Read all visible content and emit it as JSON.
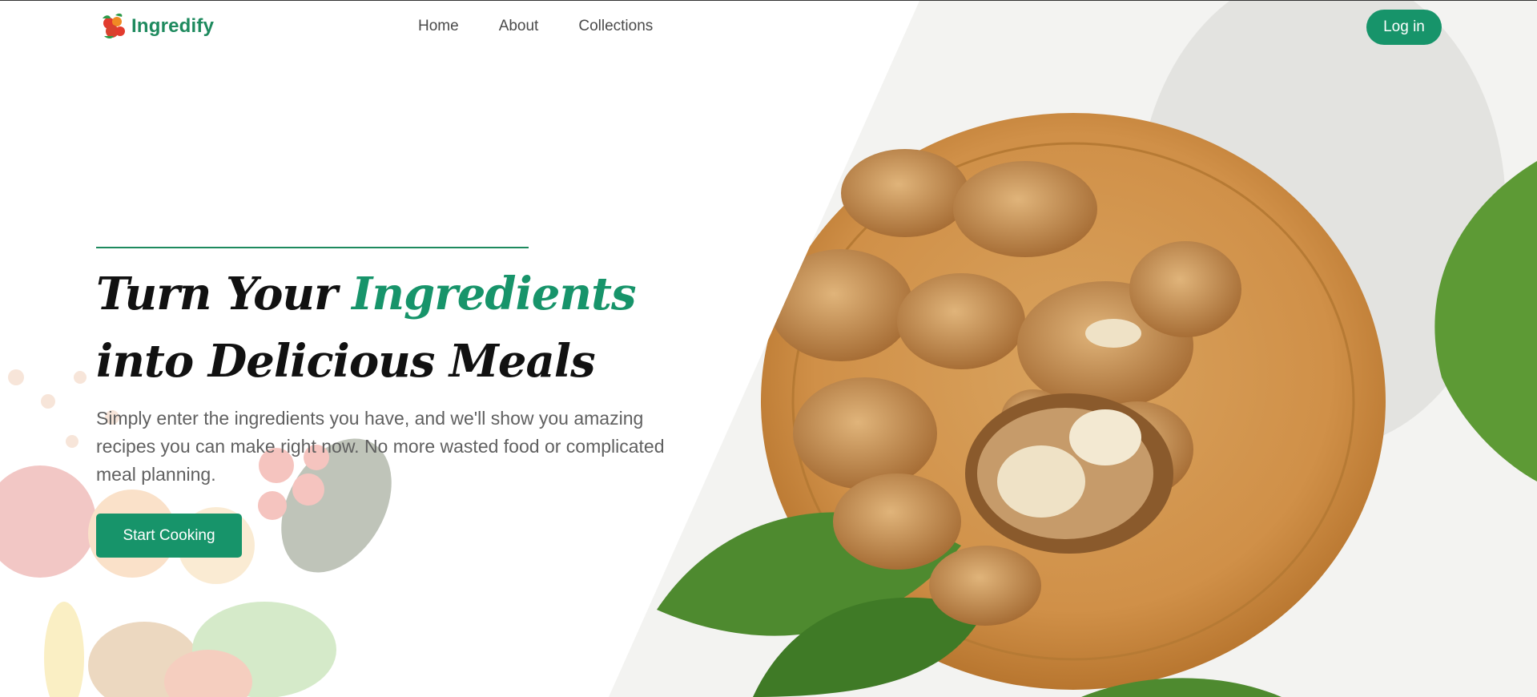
{
  "brand": {
    "name": "Ingredify"
  },
  "nav": {
    "items": [
      {
        "label": "Home"
      },
      {
        "label": "About"
      },
      {
        "label": "Collections"
      }
    ]
  },
  "header": {
    "login_label": "Log in"
  },
  "hero": {
    "headline_part1": "Turn Your ",
    "headline_highlight": "Ingredients",
    "headline_part2": " into Delicious Meals",
    "subtext": "Simply enter the ingredients you have, and we'll show you amazing recipes you can make right now. No more wasted food or complicated meal planning.",
    "cta_label": "Start Cooking",
    "image_subject": "walnuts on a wooden plate with leaves",
    "background_subject": "faded fruits and vegetables"
  },
  "colors": {
    "accent": "#17946a",
    "brand_text": "#1e8a5e",
    "headline": "#111111",
    "body_text": "#606060"
  },
  "icons": {
    "logo": "vegetable-logo-icon"
  }
}
